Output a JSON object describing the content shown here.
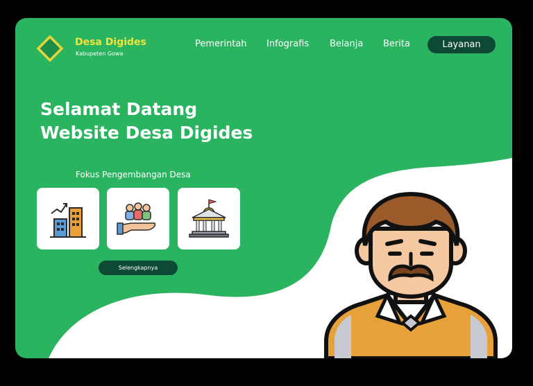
{
  "brand": {
    "name": "Desa Digides",
    "subtitle": "Kabupeten Gowa"
  },
  "nav": {
    "items": [
      "Pemerintah",
      "Infografis",
      "Belanja",
      "Berita"
    ],
    "cta": "Layanan"
  },
  "hero": {
    "line1": "Selamat Datang",
    "line2": "Website Desa Digides"
  },
  "focus": {
    "title": "Fokus Pengembangan Desa",
    "cards": [
      {
        "icon": "city-growth-icon"
      },
      {
        "icon": "community-hand-icon"
      },
      {
        "icon": "government-building-icon"
      }
    ],
    "button": "Selengkapnya"
  },
  "colors": {
    "primary_green": "#2bb460",
    "dark_green": "#0d4a36",
    "accent_yellow": "#f3e33a",
    "background": "#000000"
  },
  "illustration": {
    "icon": "male-avatar-icon"
  }
}
